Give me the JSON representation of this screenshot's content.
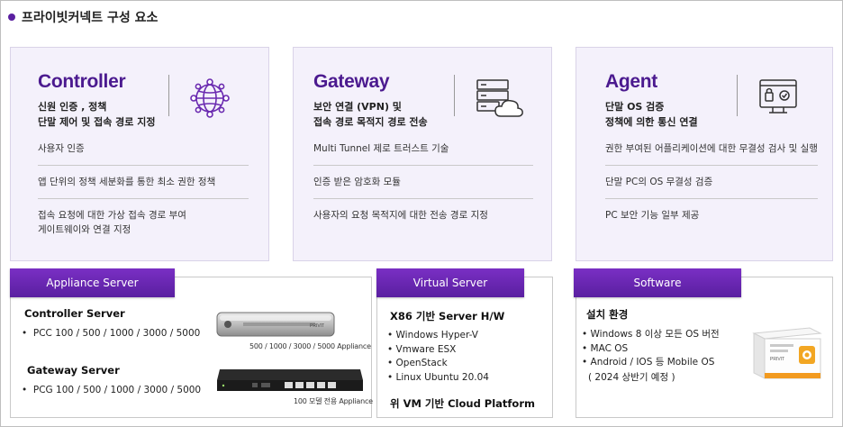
{
  "page_title": "프라이빗커넥트 구성 요소",
  "cards": [
    {
      "name": "Controller",
      "desc_line1": "신원 인증 , 정책",
      "desc_line2": "단말 제어 및 접속 경로 지정",
      "icon": "globe-network-icon",
      "items": [
        "사용자 인증",
        "앱 단위의 정책 세분화를 통한 최소 권한 정책",
        "접속 요청에 대한 가상 접속 경로 부여",
        "게이트웨이와 연결 지정"
      ]
    },
    {
      "name": "Gateway",
      "desc_line1": "보안 연결 (VPN) 및",
      "desc_line2": "접속 경로 목적지 경로 전송",
      "icon": "server-cloud-icon",
      "items": [
        "Multi Tunnel  제로 트러스트 기술",
        "인증 받은 암호화 모듈",
        "사용자의 요청 목적지에 대한 전송 경로 지정"
      ]
    },
    {
      "name": "Agent",
      "desc_line1": "단말 OS 검증",
      "desc_line2": "정책에 의한 통신 연결",
      "icon": "secure-device-icon",
      "items": [
        "권한 부여된 어플리케이션에 대한 무결성 검사 및 실행",
        "단말 PC의 OS 무결성 검증",
        "PC 보안 기능 일부 제공"
      ]
    }
  ],
  "appliance": {
    "tab": "Appliance Server",
    "controller_title": "Controller Server",
    "controller_models": "PCC 100 / 500 / 1000 / 3000 / 5000",
    "controller_caption": "500 / 1000 / 3000 / 5000 Appliance",
    "gateway_title": "Gateway Server",
    "gateway_models": "PCG 100 / 500 / 1000 / 3000 / 5000",
    "gateway_caption": "100 모델 전용 Appliance",
    "device_label": "PRIVIT"
  },
  "virtual": {
    "tab": "Virtual Server",
    "title": "X86 기반 Server H/W",
    "items": [
      "Windows Hyper-V",
      "Vmware ESX",
      "OpenStack",
      "Linux Ubuntu 20.04"
    ],
    "footer": "위 VM 기반 Cloud Platform"
  },
  "software": {
    "tab": "Software",
    "title": "설치 환경",
    "items": [
      "Windows 8 이상 모든 OS 버전",
      "MAC OS",
      "Android / IOS 등 Mobile OS"
    ],
    "note": "( 2024 상반기 예정 )",
    "box_label": "PRIVIT"
  },
  "colors": {
    "accent": "#5a1fa0",
    "card_bg": "#f4f1fb"
  }
}
